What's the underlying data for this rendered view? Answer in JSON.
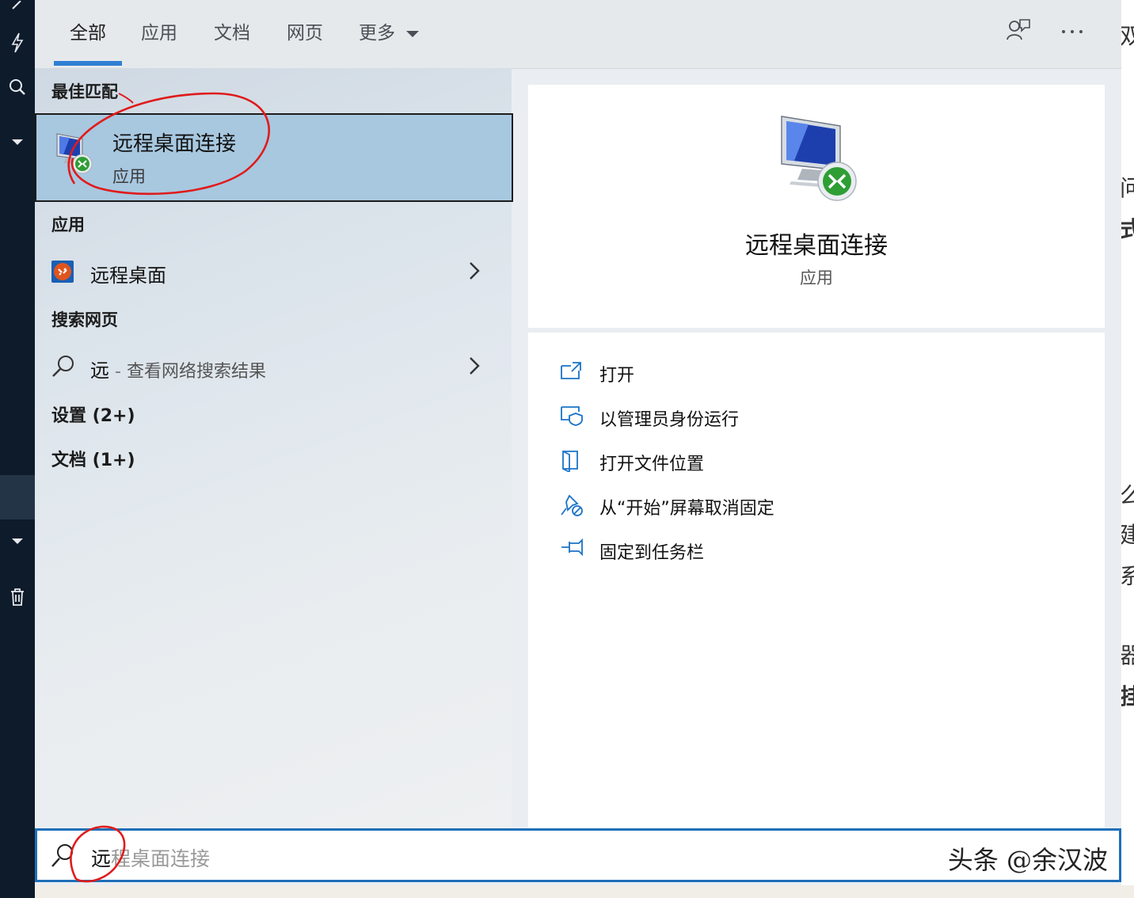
{
  "tabs": [
    {
      "label": "全部"
    },
    {
      "label": "应用"
    },
    {
      "label": "文档"
    },
    {
      "label": "网页"
    },
    {
      "label": "更多"
    }
  ],
  "header_icons": [
    "feedback-icon",
    "more-options-icon"
  ],
  "best_match": {
    "heading": "最佳匹配",
    "title": "远程桌面连接",
    "subtitle": "应用"
  },
  "apps": {
    "heading": "应用",
    "item_label": "远程桌面"
  },
  "web": {
    "heading": "搜索网页",
    "query": "远",
    "separator": " - ",
    "hint": "查看网络搜索结果"
  },
  "settings": {
    "heading": "设置 (2+)"
  },
  "documents": {
    "heading": "文档 (1+)"
  },
  "preview": {
    "title": "远程桌面连接",
    "subtitle": "应用"
  },
  "actions": [
    {
      "label": "打开",
      "icon": "open-icon"
    },
    {
      "label": "以管理员身份运行",
      "icon": "run-as-admin-icon"
    },
    {
      "label": "打开文件位置",
      "icon": "file-location-icon"
    },
    {
      "label": "从“开始”屏幕取消固定",
      "icon": "unpin-start-icon"
    },
    {
      "label": "固定到任务栏",
      "icon": "pin-taskbar-icon"
    }
  ],
  "search": {
    "typed": "远",
    "suggestion": "程桌面连接"
  },
  "watermark": "头条 @余汉波",
  "doc_fragments": [
    "双",
    "问",
    "式",
    "么",
    "建",
    "系",
    "器",
    "挂"
  ],
  "colors": {
    "accent": "#2f7fd3",
    "selection": "#a8c8e0",
    "taskbar": "#0d1b2a"
  }
}
